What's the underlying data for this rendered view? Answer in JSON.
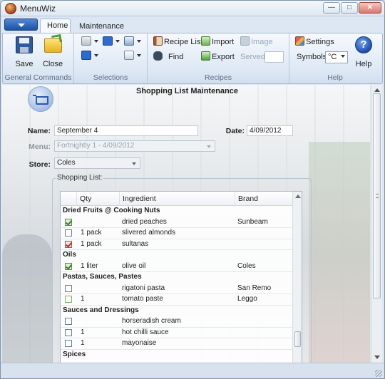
{
  "window": {
    "title": "MenuWiz"
  },
  "tabs": [
    "Home",
    "Maintenance"
  ],
  "ribbon": {
    "general": {
      "label": "General Commands",
      "save": "Save",
      "close": "Close"
    },
    "selections": {
      "label": "Selections"
    },
    "recipes": {
      "label": "Recipes",
      "recipe_list": "Recipe List",
      "import": "Import",
      "image": "Image",
      "find": "Find",
      "export": "Export",
      "served": "Served"
    },
    "help": {
      "label": "Help",
      "settings": "Settings",
      "symbols": "Symbols",
      "unit": "°C",
      "help": "Help"
    }
  },
  "form": {
    "title": "Shopping List Maintenance",
    "name_label": "Name:",
    "name_value": "September 4",
    "date_label": "Date:",
    "date_value": "4/09/2012",
    "menu_label": "Menu:",
    "menu_value": "Fortnightly 1 - 4/09/2012",
    "store_label": "Store:",
    "store_value": "Coles",
    "list_title": "Shopping List:"
  },
  "grid": {
    "headers": {
      "qty": "Qty",
      "ingredient": "Ingredient",
      "brand": "Brand"
    },
    "groups": [
      {
        "name": "Dried Fruits @ Cooking Nuts",
        "items": [
          {
            "qty": "",
            "ingredient": "dried peaches",
            "brand": "Sunbeam",
            "checked": true,
            "style": "green"
          },
          {
            "qty": "1 pack",
            "ingredient": "slivered almonds",
            "brand": "",
            "checked": false,
            "style": ""
          },
          {
            "qty": "1 pack",
            "ingredient": "sultanas",
            "brand": "",
            "checked": true,
            "style": "red"
          }
        ]
      },
      {
        "name": "Oils",
        "items": [
          {
            "qty": "1 liter",
            "ingredient": "olive oil",
            "brand": "Coles",
            "checked": true,
            "style": "green"
          }
        ]
      },
      {
        "name": "Pastas, Sauces, Pastes",
        "items": [
          {
            "qty": "",
            "ingredient": "rigatoni pasta",
            "brand": "San Remo",
            "checked": false,
            "style": ""
          },
          {
            "qty": "1",
            "ingredient": "tomato paste",
            "brand": "Leggo",
            "checked": false,
            "style": "greenish"
          }
        ]
      },
      {
        "name": "Sauces and Dressings",
        "items": [
          {
            "qty": "",
            "ingredient": "horseradish cream",
            "brand": "",
            "checked": false,
            "style": ""
          },
          {
            "qty": "1",
            "ingredient": "hot chilli sauce",
            "brand": "",
            "checked": false,
            "style": ""
          },
          {
            "qty": "1",
            "ingredient": "mayonaise",
            "brand": "",
            "checked": false,
            "style": ""
          }
        ]
      },
      {
        "name": "Spices",
        "items": []
      }
    ]
  }
}
